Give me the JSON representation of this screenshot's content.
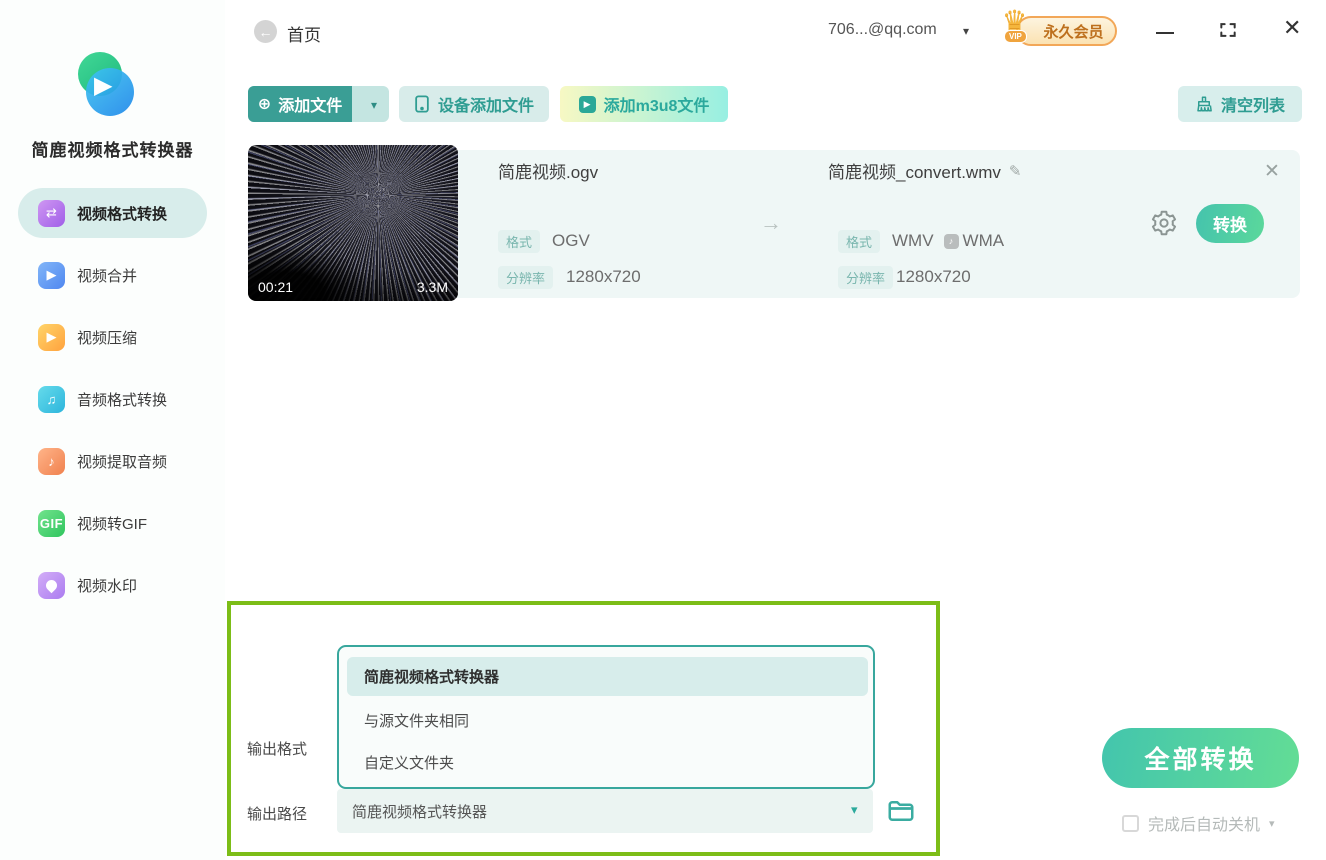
{
  "app": {
    "title": "简鹿视频格式转换器"
  },
  "titlebar": {
    "home_label": "首页",
    "account": "706...@qq.com",
    "vip_label": "永久会员",
    "vip_small": "VIP"
  },
  "sidebar": {
    "items": [
      {
        "label": "视频格式转换",
        "active": true,
        "icon": "video-convert-icon"
      },
      {
        "label": "视频合并",
        "active": false,
        "icon": "video-merge-icon"
      },
      {
        "label": "视频压缩",
        "active": false,
        "icon": "video-compress-icon"
      },
      {
        "label": "音频格式转换",
        "active": false,
        "icon": "audio-convert-icon"
      },
      {
        "label": "视频提取音频",
        "active": false,
        "icon": "extract-audio-icon"
      },
      {
        "label": "视频转GIF",
        "active": false,
        "icon": "video-to-gif-icon"
      },
      {
        "label": "视频水印",
        "active": false,
        "icon": "watermark-icon"
      }
    ],
    "gif_icon_text": "GIF"
  },
  "toolbar": {
    "add_file": "添加文件",
    "device_add": "设备添加文件",
    "add_m3u8": "添加m3u8文件",
    "clear_list": "清空列表"
  },
  "file_item": {
    "duration": "00:21",
    "size": "3.3M",
    "source": {
      "name": "简鹿视频.ogv",
      "format_label": "格式",
      "format": "OGV",
      "resolution_label": "分辨率",
      "resolution": "1280x720"
    },
    "output": {
      "name": "简鹿视频_convert.wmv",
      "format_label": "格式",
      "format_video": "WMV",
      "format_audio": "WMA",
      "resolution_label": "分辨率",
      "resolution": "1280x720"
    },
    "convert_label": "转换"
  },
  "output_panel": {
    "format_label": "输出格式",
    "path_label": "输出路径",
    "dropdown_options": [
      "简鹿视频格式转换器",
      "与源文件夹相同",
      "自定义文件夹"
    ],
    "selected_option": "简鹿视频格式转换器",
    "path_value": "简鹿视频格式转换器"
  },
  "footer": {
    "convert_all": "全部转换",
    "shutdown_label": "完成后自动关机"
  },
  "icons": {
    "back": "←",
    "caret_down": "▾",
    "plus_circle": "⊕",
    "play": "▶",
    "music_double": "♫",
    "music_single": "♪",
    "swap": "⇄",
    "arrow_right": "→",
    "pencil": "✎",
    "close": "✕",
    "crown": "♛"
  },
  "colors": {
    "teal_primary": "#3a9e95",
    "teal_light_bg": "#d8ecea",
    "accent_gradient_start": "#45c3ad",
    "accent_gradient_end": "#5bd89b",
    "highlight_green_border": "#7cbd17",
    "vip_orange": "#bd6f1d",
    "card_bg": "#eff7f6"
  }
}
